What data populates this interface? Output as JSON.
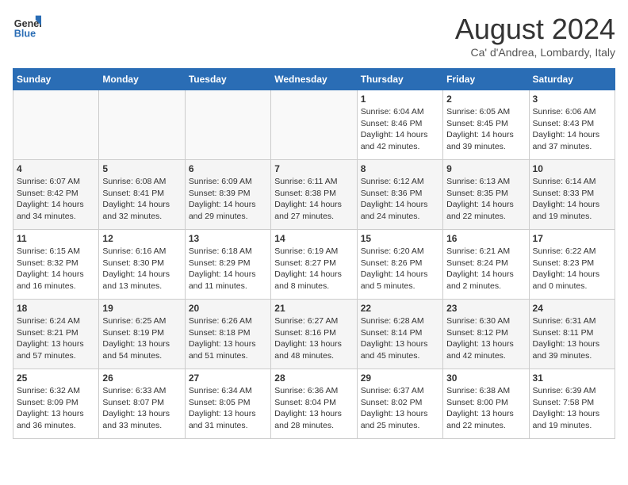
{
  "logo": {
    "line1": "General",
    "line2": "Blue"
  },
  "title": "August 2024",
  "subtitle": "Ca' d'Andrea, Lombardy, Italy",
  "days_of_week": [
    "Sunday",
    "Monday",
    "Tuesday",
    "Wednesday",
    "Thursday",
    "Friday",
    "Saturday"
  ],
  "weeks": [
    [
      {
        "day": "",
        "info": ""
      },
      {
        "day": "",
        "info": ""
      },
      {
        "day": "",
        "info": ""
      },
      {
        "day": "",
        "info": ""
      },
      {
        "day": "1",
        "info": "Sunrise: 6:04 AM\nSunset: 8:46 PM\nDaylight: 14 hours and 42 minutes."
      },
      {
        "day": "2",
        "info": "Sunrise: 6:05 AM\nSunset: 8:45 PM\nDaylight: 14 hours and 39 minutes."
      },
      {
        "day": "3",
        "info": "Sunrise: 6:06 AM\nSunset: 8:43 PM\nDaylight: 14 hours and 37 minutes."
      }
    ],
    [
      {
        "day": "4",
        "info": "Sunrise: 6:07 AM\nSunset: 8:42 PM\nDaylight: 14 hours and 34 minutes."
      },
      {
        "day": "5",
        "info": "Sunrise: 6:08 AM\nSunset: 8:41 PM\nDaylight: 14 hours and 32 minutes."
      },
      {
        "day": "6",
        "info": "Sunrise: 6:09 AM\nSunset: 8:39 PM\nDaylight: 14 hours and 29 minutes."
      },
      {
        "day": "7",
        "info": "Sunrise: 6:11 AM\nSunset: 8:38 PM\nDaylight: 14 hours and 27 minutes."
      },
      {
        "day": "8",
        "info": "Sunrise: 6:12 AM\nSunset: 8:36 PM\nDaylight: 14 hours and 24 minutes."
      },
      {
        "day": "9",
        "info": "Sunrise: 6:13 AM\nSunset: 8:35 PM\nDaylight: 14 hours and 22 minutes."
      },
      {
        "day": "10",
        "info": "Sunrise: 6:14 AM\nSunset: 8:33 PM\nDaylight: 14 hours and 19 minutes."
      }
    ],
    [
      {
        "day": "11",
        "info": "Sunrise: 6:15 AM\nSunset: 8:32 PM\nDaylight: 14 hours and 16 minutes."
      },
      {
        "day": "12",
        "info": "Sunrise: 6:16 AM\nSunset: 8:30 PM\nDaylight: 14 hours and 13 minutes."
      },
      {
        "day": "13",
        "info": "Sunrise: 6:18 AM\nSunset: 8:29 PM\nDaylight: 14 hours and 11 minutes."
      },
      {
        "day": "14",
        "info": "Sunrise: 6:19 AM\nSunset: 8:27 PM\nDaylight: 14 hours and 8 minutes."
      },
      {
        "day": "15",
        "info": "Sunrise: 6:20 AM\nSunset: 8:26 PM\nDaylight: 14 hours and 5 minutes."
      },
      {
        "day": "16",
        "info": "Sunrise: 6:21 AM\nSunset: 8:24 PM\nDaylight: 14 hours and 2 minutes."
      },
      {
        "day": "17",
        "info": "Sunrise: 6:22 AM\nSunset: 8:23 PM\nDaylight: 14 hours and 0 minutes."
      }
    ],
    [
      {
        "day": "18",
        "info": "Sunrise: 6:24 AM\nSunset: 8:21 PM\nDaylight: 13 hours and 57 minutes."
      },
      {
        "day": "19",
        "info": "Sunrise: 6:25 AM\nSunset: 8:19 PM\nDaylight: 13 hours and 54 minutes."
      },
      {
        "day": "20",
        "info": "Sunrise: 6:26 AM\nSunset: 8:18 PM\nDaylight: 13 hours and 51 minutes."
      },
      {
        "day": "21",
        "info": "Sunrise: 6:27 AM\nSunset: 8:16 PM\nDaylight: 13 hours and 48 minutes."
      },
      {
        "day": "22",
        "info": "Sunrise: 6:28 AM\nSunset: 8:14 PM\nDaylight: 13 hours and 45 minutes."
      },
      {
        "day": "23",
        "info": "Sunrise: 6:30 AM\nSunset: 8:12 PM\nDaylight: 13 hours and 42 minutes."
      },
      {
        "day": "24",
        "info": "Sunrise: 6:31 AM\nSunset: 8:11 PM\nDaylight: 13 hours and 39 minutes."
      }
    ],
    [
      {
        "day": "25",
        "info": "Sunrise: 6:32 AM\nSunset: 8:09 PM\nDaylight: 13 hours and 36 minutes."
      },
      {
        "day": "26",
        "info": "Sunrise: 6:33 AM\nSunset: 8:07 PM\nDaylight: 13 hours and 33 minutes."
      },
      {
        "day": "27",
        "info": "Sunrise: 6:34 AM\nSunset: 8:05 PM\nDaylight: 13 hours and 31 minutes."
      },
      {
        "day": "28",
        "info": "Sunrise: 6:36 AM\nSunset: 8:04 PM\nDaylight: 13 hours and 28 minutes."
      },
      {
        "day": "29",
        "info": "Sunrise: 6:37 AM\nSunset: 8:02 PM\nDaylight: 13 hours and 25 minutes."
      },
      {
        "day": "30",
        "info": "Sunrise: 6:38 AM\nSunset: 8:00 PM\nDaylight: 13 hours and 22 minutes."
      },
      {
        "day": "31",
        "info": "Sunrise: 6:39 AM\nSunset: 7:58 PM\nDaylight: 13 hours and 19 minutes."
      }
    ]
  ]
}
